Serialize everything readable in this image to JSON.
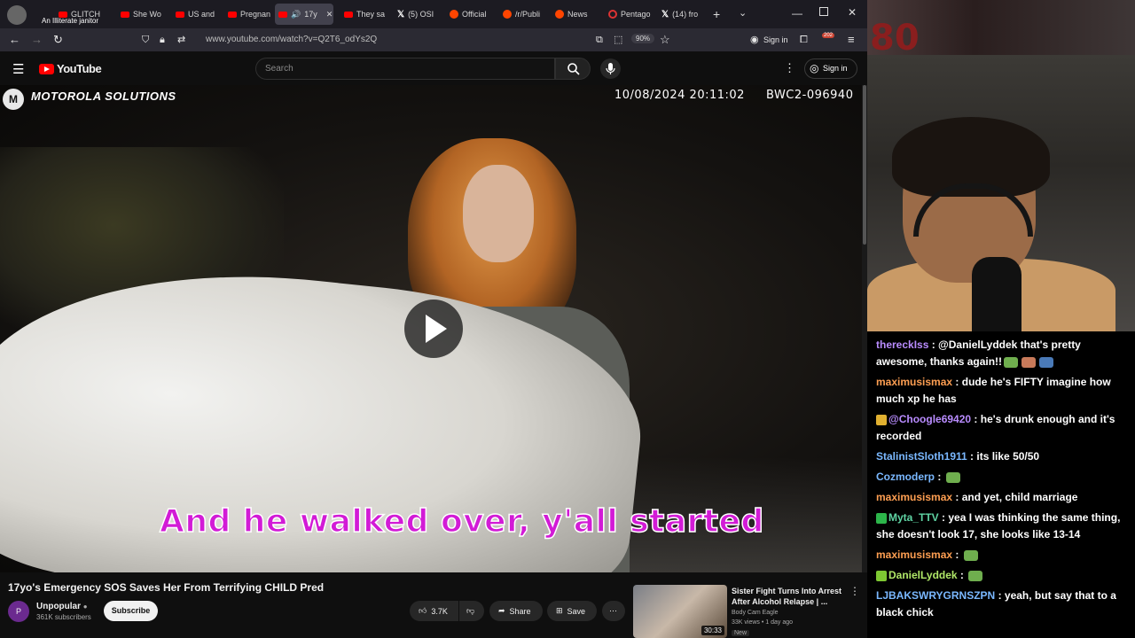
{
  "browser": {
    "tabs": [
      {
        "label": "GLITCH",
        "icon": "youtube-icon"
      },
      {
        "label": "She Wo",
        "icon": "youtube-icon"
      },
      {
        "label": "US and",
        "icon": "youtube-icon"
      },
      {
        "label": "Pregnan",
        "icon": "youtube-icon"
      },
      {
        "label": "17y",
        "icon": "youtube-icon"
      },
      {
        "label": "They sa",
        "icon": "youtube-icon"
      },
      {
        "label": "(5) OSI",
        "icon": "x-icon"
      },
      {
        "label": "Official",
        "icon": "reddit-icon"
      },
      {
        "label": "/r/Publi",
        "icon": "reddit-icon"
      },
      {
        "label": "News",
        "icon": "reddit-icon"
      },
      {
        "label": "Pentago",
        "icon": "page-icon"
      },
      {
        "label": "(14) fro",
        "icon": "x-icon"
      }
    ],
    "tooltip": "An Illiterate janitor",
    "url": "www.youtube.com/watch?v=Q2T6_odYs2Q",
    "zoom": "90%",
    "signin": "Sign in",
    "notif_count": "202"
  },
  "youtube": {
    "logo_text": "YouTube",
    "search_placeholder": "Search",
    "signin": "Sign in"
  },
  "video": {
    "brand": "MOTOROLA SOLUTIONS",
    "timestamp": "10/08/2024 20:11:02",
    "camera_id": "BWC2-096940",
    "caption": "And he walked over, y'all started",
    "title": "17yo's Emergency SOS Saves Her From Terrifying CHILD Pred",
    "channel": "Unpopular",
    "subscribers": "361K subscribers",
    "subscribe": "Subscribe",
    "likes": "3.7K",
    "share": "Share",
    "save": "Save"
  },
  "recommended": {
    "title": "Sister Fight Turns Into Arrest After Alcohol Relapse | ...",
    "channel": "Body Cam Eagle",
    "meta": "33K views • 1 day ago",
    "badge": "New",
    "duration": "30:33"
  },
  "stream": {
    "logo": "80"
  },
  "chat": [
    {
      "user": "thereckIss",
      "color": "#b98cff",
      "text": "@DanielLyddek that's pretty awesome, thanks again!!",
      "emotes": 3
    },
    {
      "user": "maximusismax",
      "color": "#ff9f52",
      "text": "dude he's FIFTY imagine how much xp he has",
      "emotes": 0
    },
    {
      "user": "@Choogle69420",
      "color": "#b98cff",
      "text": "he's drunk enough and it's recorded",
      "emotes": 0,
      "badge": "#e0b030"
    },
    {
      "user": "StalinistSloth1911",
      "color": "#7ab8ff",
      "text": "its like 50/50",
      "emotes": 0
    },
    {
      "user": "Cozmoderp",
      "color": "#7ab8ff",
      "text": "",
      "emotes": 1
    },
    {
      "user": "maximusismax",
      "color": "#ff9f52",
      "text": "and yet, child marriage",
      "emotes": 0
    },
    {
      "user": "Myta_TTV",
      "color": "#5fd3a3",
      "text": "yea I was thinking the same thing, she doesn't look 17, she looks like 13-14",
      "emotes": 0,
      "badge": "#2cb54a"
    },
    {
      "user": "maximusismax",
      "color": "#ff9f52",
      "text": "",
      "emotes": 1
    },
    {
      "user": "DanielLyddek",
      "color": "#b0e868",
      "text": "",
      "emotes": 1,
      "badge": "#7ec832"
    },
    {
      "user": "LJBAKSWRYGRNSZPN",
      "color": "#7ab8ff",
      "text": "yeah, but say that to a black chick",
      "emotes": 0
    }
  ],
  "colors": {
    "caption": "#d21bd6",
    "youtube_red": "#ff0000"
  }
}
